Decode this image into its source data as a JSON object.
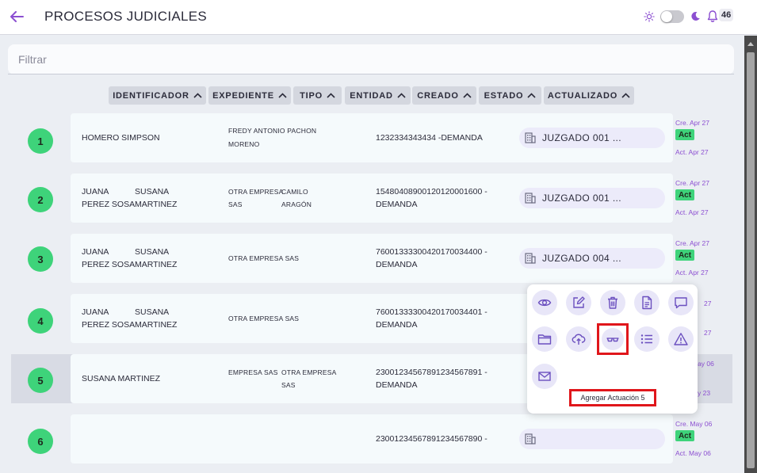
{
  "header": {
    "title": "PROCESOS JUDICIALES",
    "notification_count": "46"
  },
  "filter": {
    "placeholder": "Filtrar",
    "value": ""
  },
  "columns": [
    "IDENTIFICADOR",
    "EXPEDIENTE",
    "TIPO",
    "ENTIDAD",
    "CREADO",
    "ESTADO",
    "ACTUALIZADO"
  ],
  "rows": [
    {
      "num": "1",
      "demandante": [
        "HOMERO SIMPSON"
      ],
      "demandado": [
        "FREDY ANTONIO PACHON",
        "MORENO"
      ],
      "radicado": [
        "1232334343434 -DEMANDA"
      ],
      "juzgado": "JUZGADO 001 ...",
      "creado": "Cre. Apr 27",
      "estado": "Act",
      "actualizado": "Act. Apr 27"
    },
    {
      "num": "2",
      "demandante": [
        "JUANA",
        "PEREZ SOSA",
        "SUSANA",
        "MARTINEZ"
      ],
      "demandado": [
        "OTRA EMPRESA",
        "SAS",
        "CAMILO",
        "ARAGÓN"
      ],
      "radicado": [
        "15480408900120120001600 -",
        "DEMANDA"
      ],
      "juzgado": "JUZGADO 001 ...",
      "creado": "Cre. Apr 27",
      "estado": "Act",
      "actualizado": "Act. Apr 27"
    },
    {
      "num": "3",
      "demandante": [
        "JUANA",
        "PEREZ SOSA",
        "SUSANA",
        "MARTINEZ"
      ],
      "demandado": [
        "OTRA EMPRESA SAS"
      ],
      "radicado": [
        "76001333300420170034400 -",
        "DEMANDA"
      ],
      "juzgado": "JUZGADO 004 ...",
      "creado": "Cre. Apr 27",
      "estado": "Act",
      "actualizado": "Act. Apr 27"
    },
    {
      "num": "4",
      "demandante": [
        "JUANA",
        "PEREZ SOSA",
        "SUSANA",
        "MARTINEZ"
      ],
      "demandado": [
        "OTRA EMPRESA SAS"
      ],
      "radicado": [
        "76001333300420170034401 -",
        "DEMANDA"
      ],
      "juzgado": "",
      "creado": "27",
      "estado": "",
      "actualizado": "27"
    },
    {
      "num": "5",
      "demandante": [
        "SUSANA MARTINEZ"
      ],
      "demandado": [
        "EMPRESA SAS",
        "OTRA EMPRESA",
        "SAS"
      ],
      "radicado": [
        "23001234567891234567891 -",
        "DEMANDA"
      ],
      "juzgado": "",
      "creado": "May 06",
      "estado": "",
      "actualizado": "y 23"
    },
    {
      "num": "6",
      "demandante": [],
      "demandado": [],
      "radicado": [
        "23001234567891234567890 -"
      ],
      "juzgado": "",
      "creado": "Cre. May 06",
      "estado": "Act",
      "actualizado": "Act. May 06"
    }
  ],
  "actions_popover": {
    "icons": [
      "eye-icon",
      "edit-icon",
      "trash-icon",
      "document-icon",
      "comment-icon",
      "folder-icon",
      "cloud-upload-icon",
      "glasses-icon",
      "list-icon",
      "warning-icon",
      "mail-icon"
    ],
    "tooltip": "Agregar Actuación 5"
  },
  "colors": {
    "accent": "#8c4fd1",
    "badge_green": "#3ed37a",
    "highlight_red": "#e0161b"
  }
}
